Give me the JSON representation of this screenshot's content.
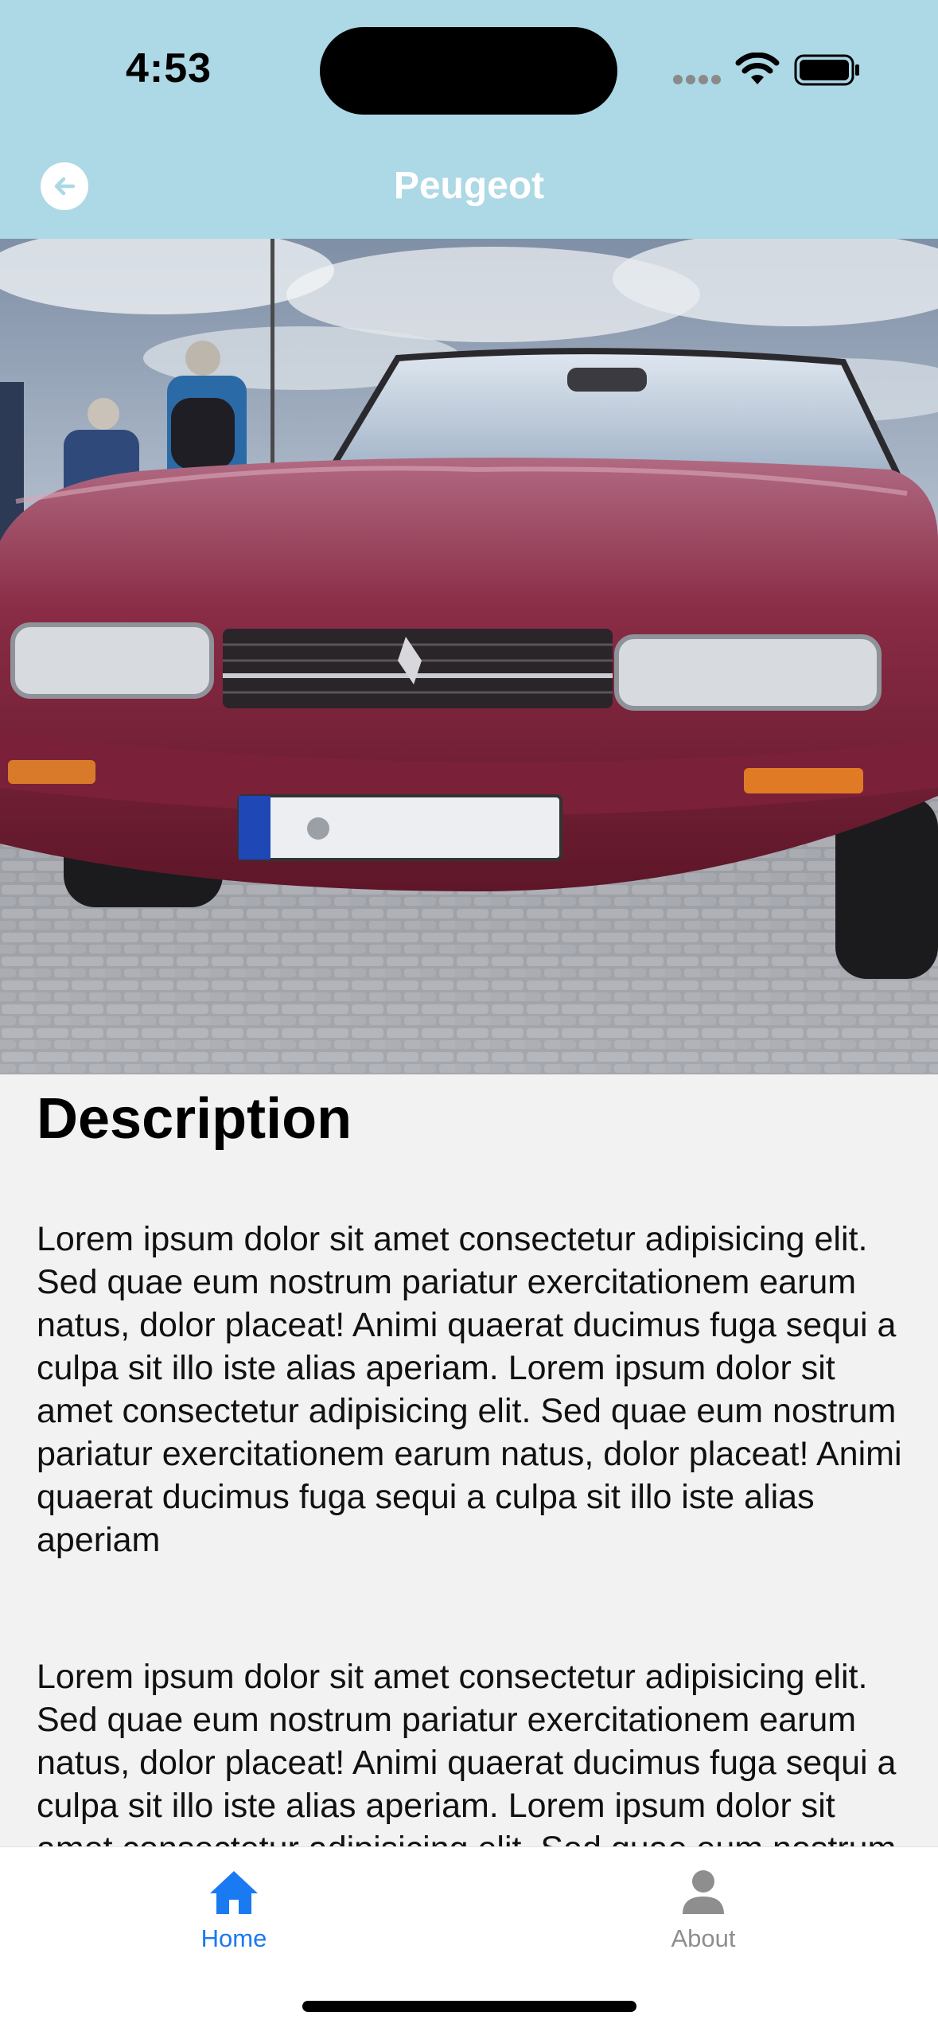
{
  "status_bar": {
    "time": "4:53"
  },
  "header": {
    "title": "Peugeot"
  },
  "hero": {
    "subject": "red Peugeot convertible on cobblestones"
  },
  "description": {
    "heading": "Description",
    "paragraphs": [
      "Lorem ipsum dolor sit amet consectetur adipisicing elit. Sed quae eum nostrum pariatur exercitationem earum natus, dolor placeat! Animi quaerat ducimus fuga sequi a culpa sit illo iste alias aperiam. Lorem ipsum dolor sit amet consectetur adipisicing elit. Sed quae eum nostrum pariatur exercitationem earum natus, dolor placeat! Animi quaerat ducimus fuga sequi a culpa sit illo iste alias aperiam",
      "Lorem ipsum dolor sit amet consectetur adipisicing elit. Sed quae eum nostrum pariatur exercitationem earum natus, dolor placeat! Animi quaerat ducimus fuga sequi a culpa sit illo iste alias aperiam. Lorem ipsum dolor sit amet consectetur adipisicing elit. Sed quae eum nostrum pariatur exercitationem earum natus, dolor placeat! Animi quaerat ducimus fuga sequi a culpa sit illo iste alias aperiam"
    ]
  },
  "tabs": [
    {
      "label": "Home",
      "icon": "home-icon",
      "active": true
    },
    {
      "label": "About",
      "icon": "person-icon",
      "active": false
    }
  ],
  "colors": {
    "header_bg": "#add8e6",
    "accent": "#1a7af2",
    "inactive_tab": "#8e8e8e",
    "content_bg": "#f2f2f2"
  }
}
